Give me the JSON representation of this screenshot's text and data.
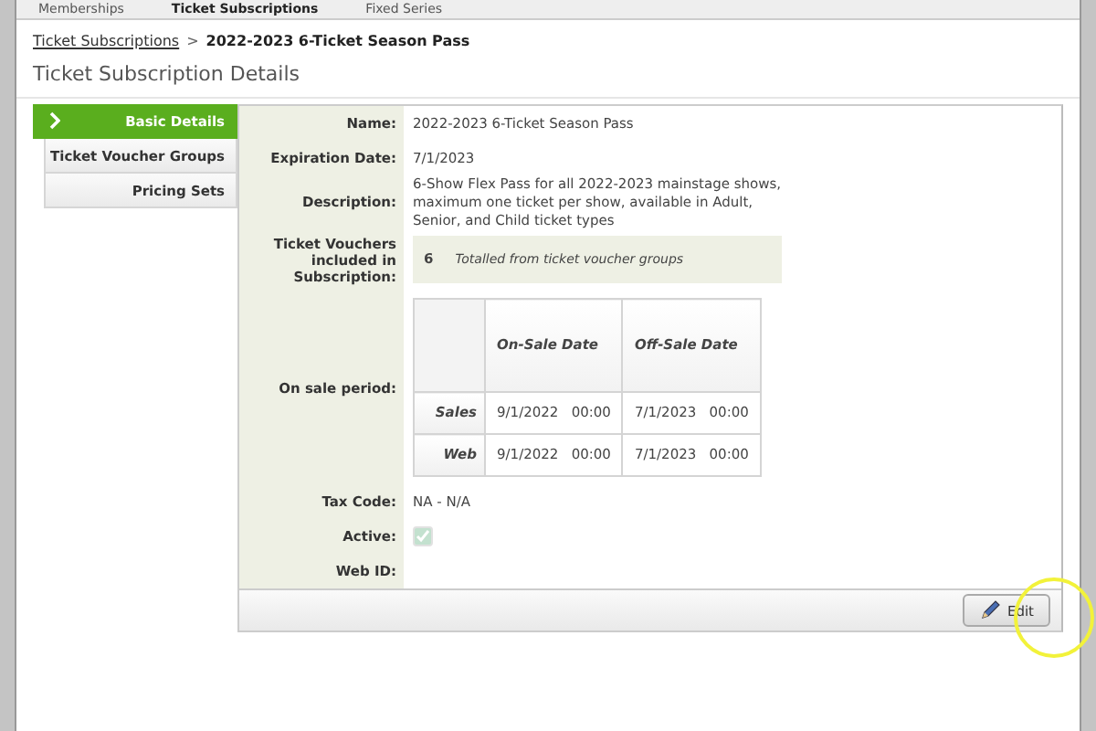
{
  "top_tabs": [
    {
      "label": "Memberships",
      "selected": false
    },
    {
      "label": "Ticket Subscriptions",
      "selected": true
    },
    {
      "label": "Fixed Series",
      "selected": false
    }
  ],
  "breadcrumb": {
    "link": "Ticket Subscriptions",
    "separator": ">",
    "current": "2022-2023 6-Ticket Season Pass"
  },
  "page_title": "Ticket Subscription Details",
  "sidebar": {
    "items": [
      {
        "label": "Basic Details",
        "selected": true
      },
      {
        "label": "Ticket Voucher Groups",
        "selected": false
      },
      {
        "label": "Pricing Sets",
        "selected": false
      }
    ]
  },
  "fields": [
    {
      "kind": "text",
      "label": "Name:",
      "value": "2022-2023 6-Ticket Season Pass"
    },
    {
      "kind": "text",
      "label": "Expiration Date:",
      "value": "7/1/2023"
    },
    {
      "kind": "text",
      "label": "Description:",
      "value": "6-Show Flex Pass for all 2022-2023 mainstage shows, maximum one ticket per show, available in Adult, Senior, and Child ticket types"
    },
    {
      "kind": "vouchers",
      "label": "Ticket Vouchers included in Subscription:",
      "count": "6",
      "note": "Totalled from ticket voucher groups"
    },
    {
      "kind": "period",
      "label": "On sale period:",
      "columns": [
        "On-Sale Date",
        "Off-Sale Date"
      ],
      "rows": [
        {
          "name": "Sales",
          "cells": [
            "9/1/2022   00:00",
            "7/1/2023   00:00"
          ]
        },
        {
          "name": "Web",
          "cells": [
            "9/1/2022   00:00",
            "7/1/2023   00:00"
          ]
        }
      ]
    },
    {
      "kind": "text",
      "label": "Tax Code:",
      "value": "NA - N/A"
    },
    {
      "kind": "checkbox",
      "label": "Active:",
      "checked": true,
      "disabled": true
    },
    {
      "kind": "text",
      "label": "Web ID:"
    }
  ],
  "edit_button": "Edit"
}
